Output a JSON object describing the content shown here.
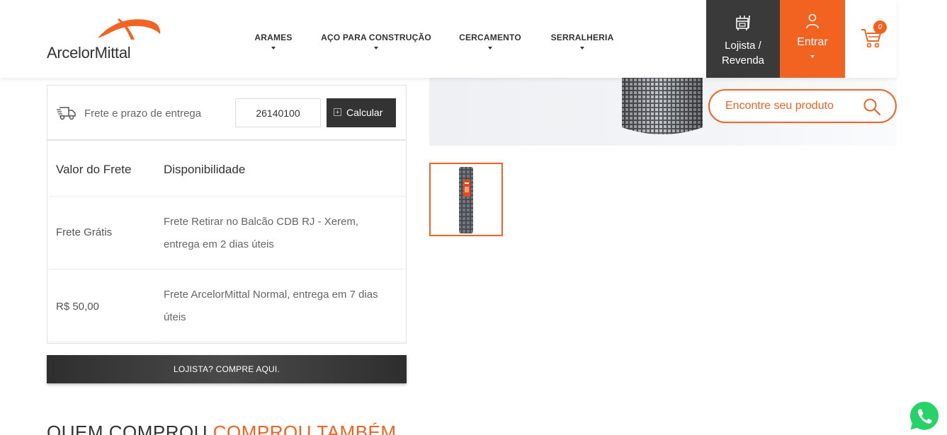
{
  "header": {
    "logo_text": "ArcelorMittal",
    "nav": [
      {
        "label": "ARAMES"
      },
      {
        "label": "AÇO PARA CONSTRUÇÃO"
      },
      {
        "label": "CERCAMENTO"
      },
      {
        "label": "SERRALHERIA"
      }
    ],
    "lojista_line1": "Lojista /",
    "lojista_line2": "Revenda",
    "entrar_label": "Entrar",
    "cart_count": "0"
  },
  "search": {
    "placeholder": "Encontre seu produto"
  },
  "shipping": {
    "label": "Frete e prazo de entrega",
    "cep_value": "26140100",
    "calc_label": "Calcular",
    "col_headers": [
      "Valor do Frete",
      "Disponibilidade"
    ],
    "rows": [
      {
        "price": "Frete Grátis",
        "availability": "Frete Retirar no Balcão CDB RJ - Xerem, entrega em 2 dias úteis"
      },
      {
        "price": "R$ 50,00",
        "availability": "Frete ArcelorMittal Normal, entrega em 7 dias úteis"
      }
    ]
  },
  "buy_button_label": "LOJISTA? COMPRE AQUI.",
  "section_title": {
    "part1": "QUEM COMPROU ",
    "part2": "COMPROU TAMBÉM"
  },
  "colors": {
    "accent": "#f26322",
    "dark": "#333333",
    "whatsapp": "#25d366"
  },
  "icons": [
    "arcelormittal-logo-icon",
    "chevron-down-icon",
    "store-icon",
    "user-icon",
    "cart-icon",
    "search-icon",
    "truck-icon",
    "plus-square-icon",
    "whatsapp-icon"
  ]
}
